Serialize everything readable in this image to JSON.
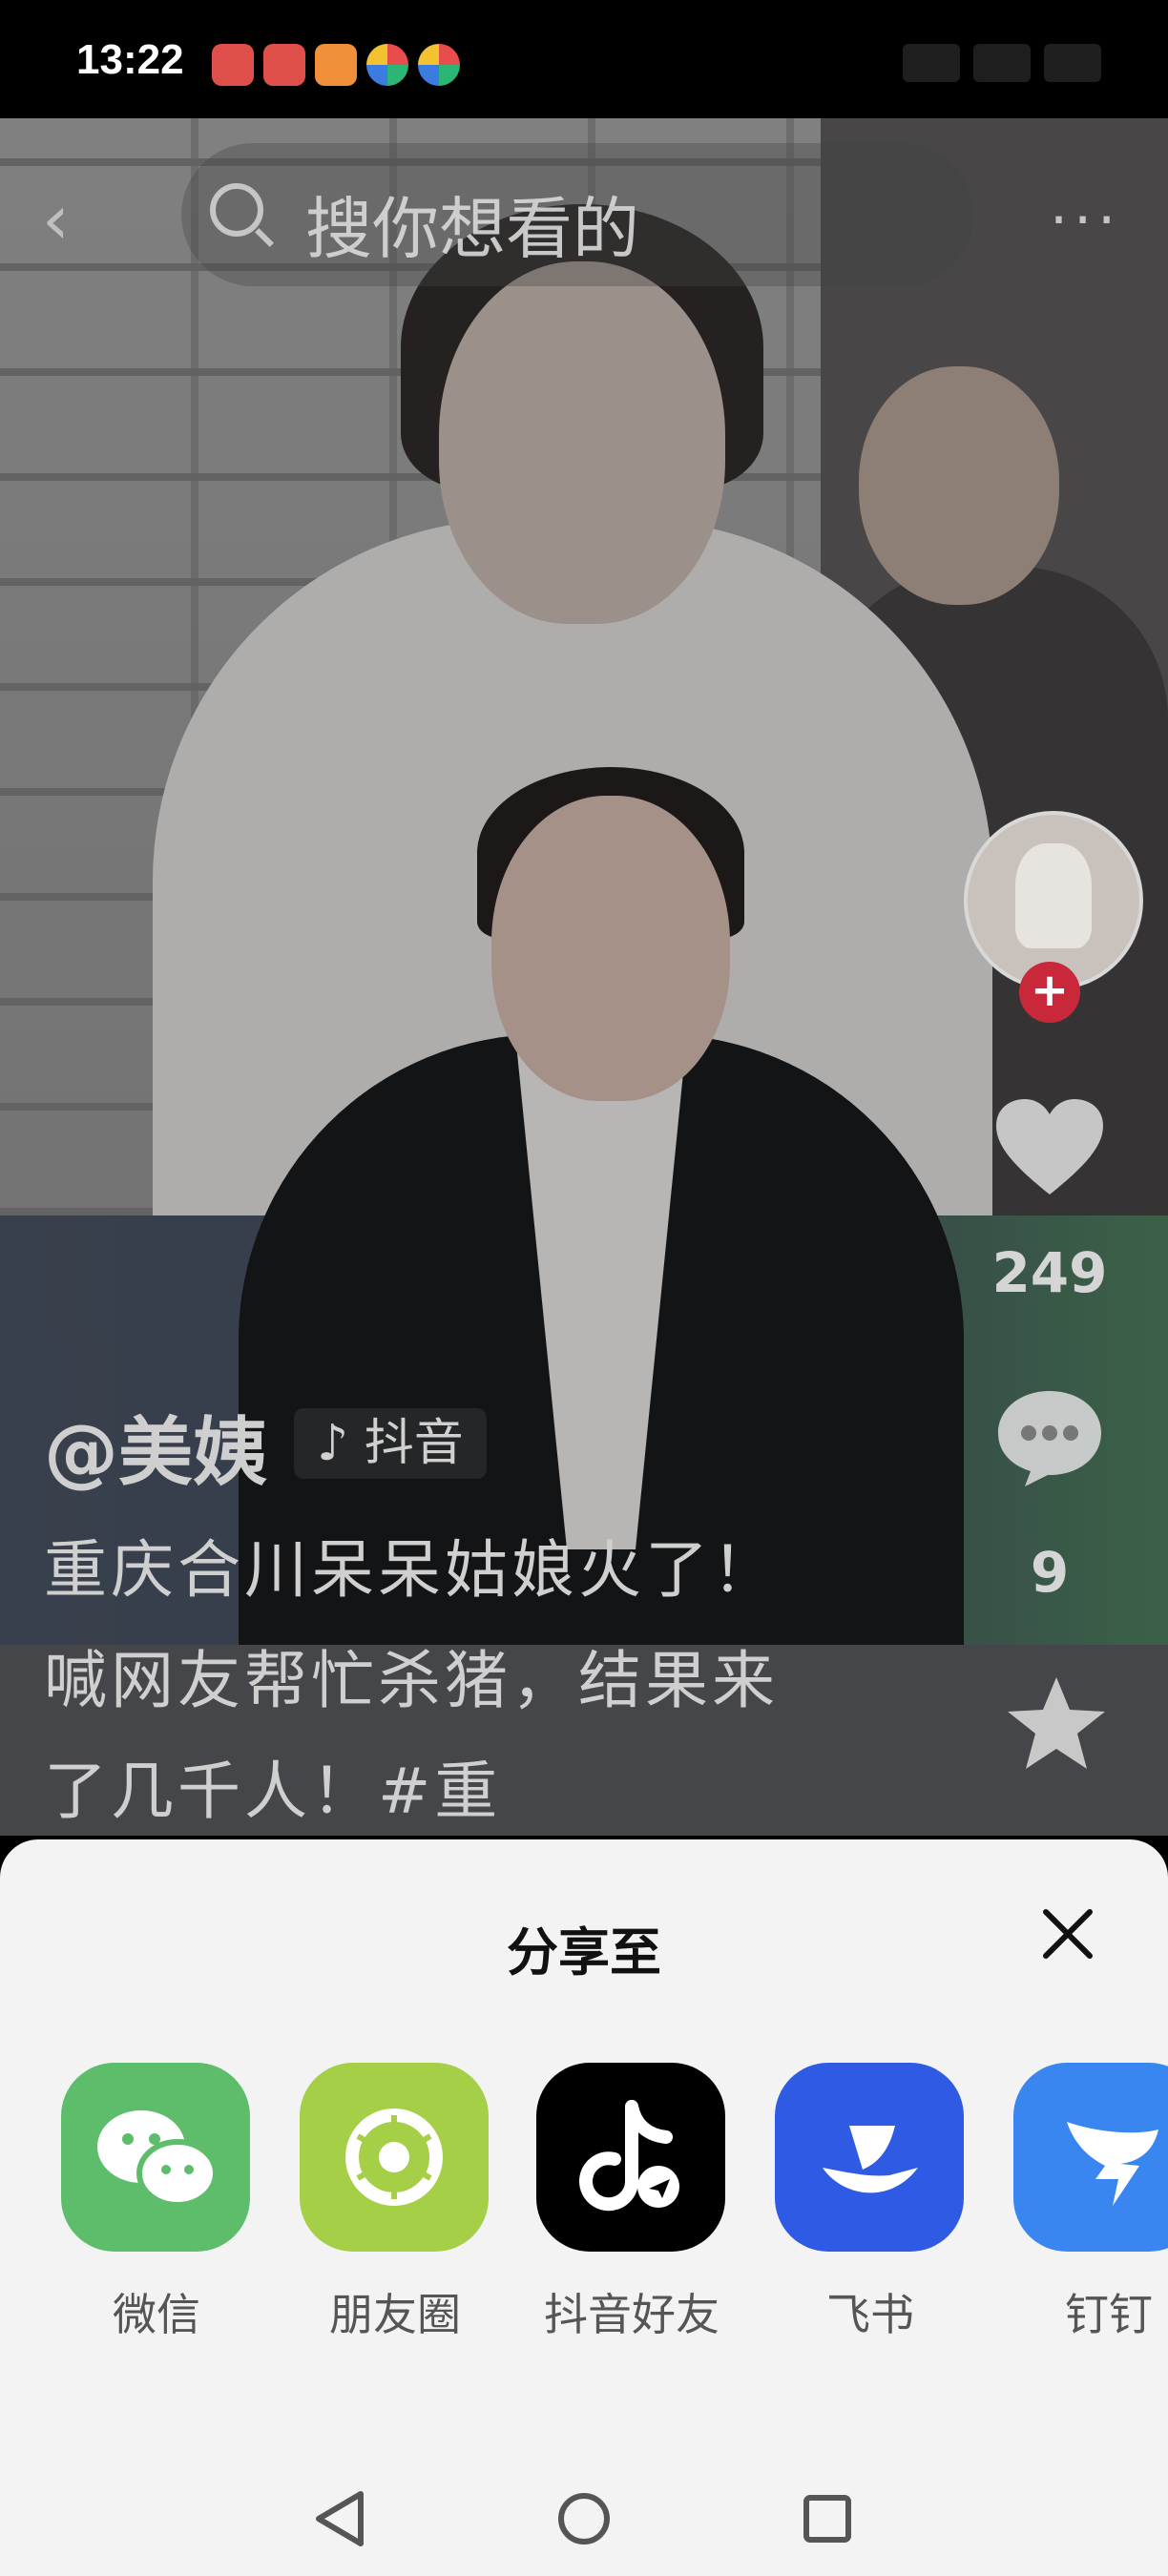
{
  "status_bar": {
    "time": "13:22"
  },
  "top_nav": {
    "search_placeholder": "搜你想看的",
    "more_glyph": "···"
  },
  "right_rail": {
    "likes": "249",
    "comments": "9"
  },
  "caption": {
    "author": "@美姨",
    "platform": "抖音",
    "text": "重庆合川呆呆姑娘火了！喊网友帮忙杀猪，结果来了几千人！#重"
  },
  "share_sheet": {
    "title": "分享至",
    "targets": [
      {
        "label": "微信",
        "icon": "wechat-icon",
        "color": "#5ebd6b"
      },
      {
        "label": "朋友圈",
        "icon": "moments-icon",
        "color": "#a5cf46"
      },
      {
        "label": "抖音好友",
        "icon": "douyin-icon",
        "color": "#000000"
      },
      {
        "label": "飞书",
        "icon": "feishu-icon",
        "color": "#2f5ae4"
      },
      {
        "label": "钉钉",
        "icon": "dingtalk-icon",
        "color": "#3a86f0"
      }
    ]
  }
}
